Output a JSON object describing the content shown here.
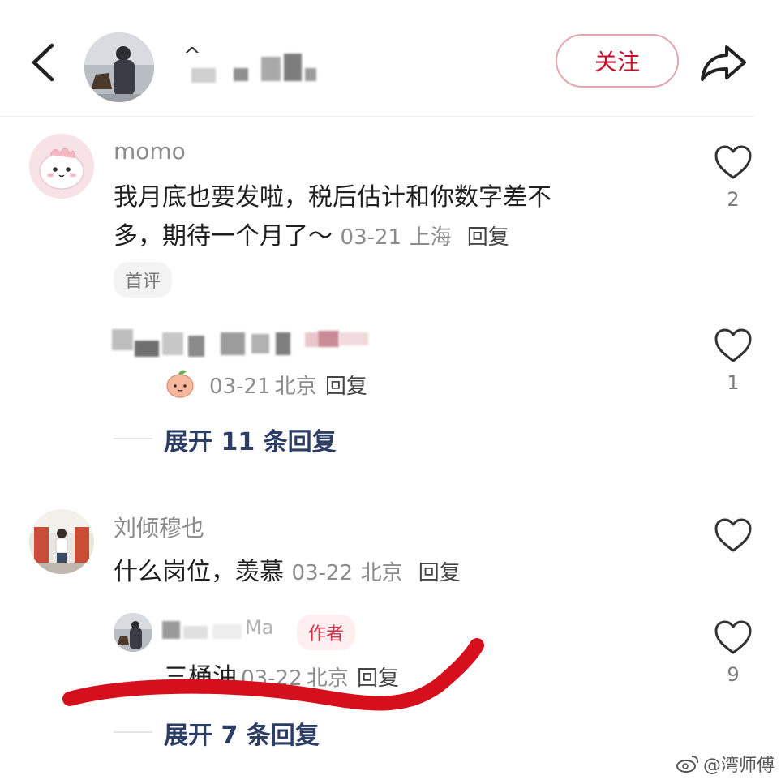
{
  "header": {
    "name_visible_prefix": "^",
    "follow_label": "关注"
  },
  "comments": [
    {
      "username": "momo",
      "text_line1": "我月底也要发啦，税后估计和你数字差不",
      "text_line2": "多，期待一个月了～",
      "date": "03-21",
      "location": "上海",
      "reply_label": "回复",
      "tag": "首评",
      "likes": "2",
      "sub_reply": {
        "date": "03-21",
        "location": "北京",
        "reply_label": "回复",
        "likes": "1"
      },
      "expand_label": "展开 11 条回复"
    },
    {
      "username": "刘倾穆也",
      "text": "什么岗位，羡慕",
      "date": "03-22",
      "location": "北京",
      "reply_label": "回复",
      "likes": "",
      "sub_reply": {
        "username_visible": "Ma",
        "author_tag": "作者",
        "text": "三桶油",
        "date": "03-22",
        "location": "北京",
        "reply_label": "回复",
        "likes": "9"
      },
      "expand_label": "展开 7 条回复"
    }
  ],
  "watermark": "@湾师傅",
  "colors": {
    "accent": "#c8102e",
    "annotation_stroke": "#d60f1c",
    "expand_text": "#2c3e66"
  }
}
